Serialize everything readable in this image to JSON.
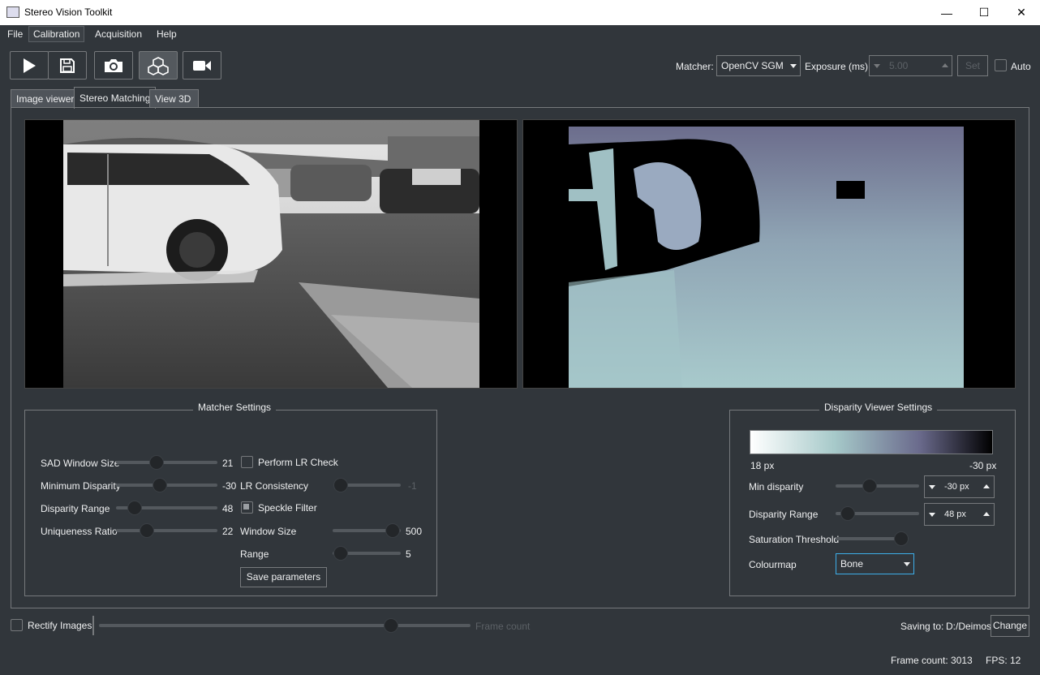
{
  "window": {
    "title": "Stereo Vision Toolkit",
    "controls": [
      "—",
      "☐",
      "✕"
    ]
  },
  "menu": [
    "File",
    "Calibration",
    "Acquisition",
    "Help"
  ],
  "toolbar": {
    "buttons": [
      "play-icon",
      "save-icon",
      "camera-icon",
      "cubes-icon",
      "video-icon"
    ],
    "matcher_label": "Matcher:",
    "matcher_value": "OpenCV SGM",
    "exposure_label": "Exposure (ms)",
    "exposure_value": "5.00",
    "set_label": "Set",
    "auto_label": "Auto"
  },
  "tabs": [
    "Image viewer",
    "Stereo Matching",
    "View 3D"
  ],
  "active_tab": "Stereo Matching",
  "matcher_settings": {
    "title": "Matcher Settings",
    "sliders": [
      {
        "label": "SAD Window  Size",
        "value": "21",
        "pos": 0.38
      },
      {
        "label": "Minimum Disparity",
        "value": "-30",
        "pos": 0.42
      },
      {
        "label": "Disparity Range",
        "value": "48",
        "pos": 0.13
      },
      {
        "label": "Uniqueness Ratio",
        "value": "22",
        "pos": 0.27
      }
    ],
    "perform_lr_check": {
      "label": "Perform LR Check",
      "checked": false
    },
    "lr_consistency": {
      "label": "LR Consistency",
      "value": "-1",
      "pos": 0.0
    },
    "speckle_filter": {
      "label": "Speckle Filter",
      "checked": true
    },
    "window_size": {
      "label": "Window Size",
      "value": "500",
      "pos": 1.0
    },
    "range": {
      "label": "Range",
      "value": "5",
      "pos": 0.0
    },
    "save_button": "Save parameters"
  },
  "disparity_viewer": {
    "title": "Disparity Viewer Settings",
    "colorbar_min": "18 px",
    "colorbar_max": "-30 px",
    "min_disparity_label": "Min disparity",
    "min_disparity_value": "-30 px",
    "disparity_range_label": "Disparity Range",
    "disparity_range_value": "48 px",
    "saturation_label": "Saturation Threshold",
    "colourmap_label": "Colourmap",
    "colourmap_value": "Bone",
    "colors": [
      "#ffffff",
      "#a6c9c9",
      "#6a6a8c",
      "#000000"
    ]
  },
  "bottom": {
    "rectify_label": "Rectify Images",
    "frame_slider_label": "Frame count",
    "saving_label": "Saving to:",
    "saving_path": "D:/Deimos",
    "change_label": "Change"
  },
  "status": {
    "frame_count": "Frame count: 3013",
    "fps": "FPS: 12"
  }
}
